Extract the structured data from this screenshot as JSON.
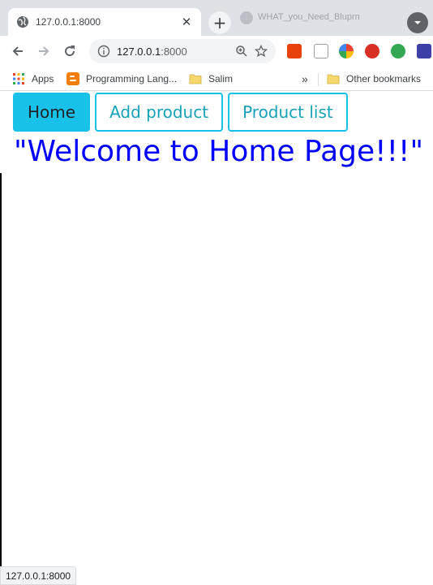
{
  "browser": {
    "tab": {
      "title": "127.0.0.1:8000",
      "close_glyph": "✕",
      "icon": "globe-icon"
    },
    "new_tab_glyph": "+",
    "background_tab_title": "WHAT_you_Need_Bluprn",
    "address_bar": {
      "host": "127.0.0.1",
      "port": ":8000"
    },
    "bookmarks": {
      "apps_label": "Apps",
      "items": [
        {
          "label": "Programming Lang...",
          "icon": "blogger-icon"
        },
        {
          "label": "Salim",
          "icon": "folder-icon"
        }
      ],
      "overflow_glyph": "»",
      "other_label": "Other bookmarks"
    },
    "status_url": "127.0.0.1:8000"
  },
  "page": {
    "nav": {
      "home_label": "Home",
      "add_product_label": "Add product",
      "product_list_label": "Product list"
    },
    "heading": "\"Welcome to Home Page!!!\""
  },
  "colors": {
    "accent": "#17c1e8",
    "outline_text": "#17a2b8",
    "heading": "#0000ff"
  }
}
